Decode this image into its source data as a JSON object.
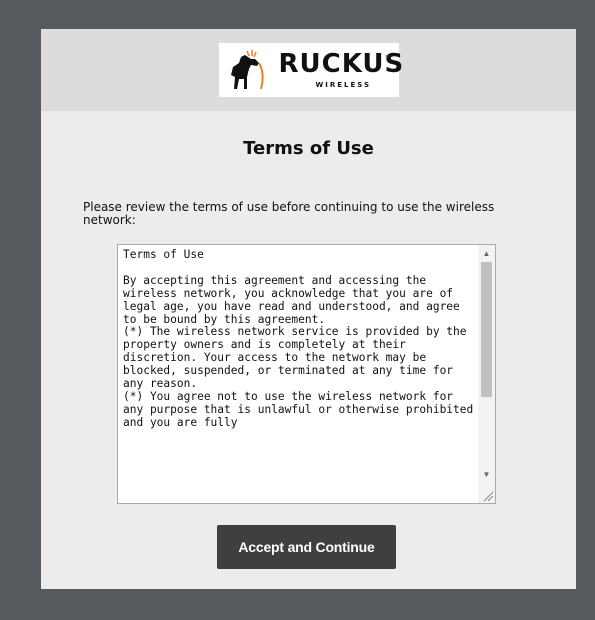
{
  "brand": {
    "name": "RUCKUS",
    "tagline": "WIRELESS",
    "trademark": "™"
  },
  "page": {
    "title": "Terms of Use",
    "prompt": "Please review the terms of use before continuing to use the wireless network:"
  },
  "terms": {
    "text": "Terms of Use\n\nBy accepting this agreement and accessing the wireless network, you acknowledge that you are of legal age, you have read and understood, and agree to be bound by this agreement.\n(*) The wireless network service is provided by the property owners and is completely at their discretion. Your access to the network may be blocked, suspended, or terminated at any time for any reason.\n(*) You agree not to use the wireless network for any purpose that is unlawful or otherwise prohibited and you are fully"
  },
  "actions": {
    "accept_label": "Accept and Continue"
  },
  "colors": {
    "outer_background": "#565a5e",
    "card_background": "#ececec",
    "header_background": "#dcdcdc",
    "button_background": "#3f3f3f",
    "logo_accent": "#e8821e"
  }
}
